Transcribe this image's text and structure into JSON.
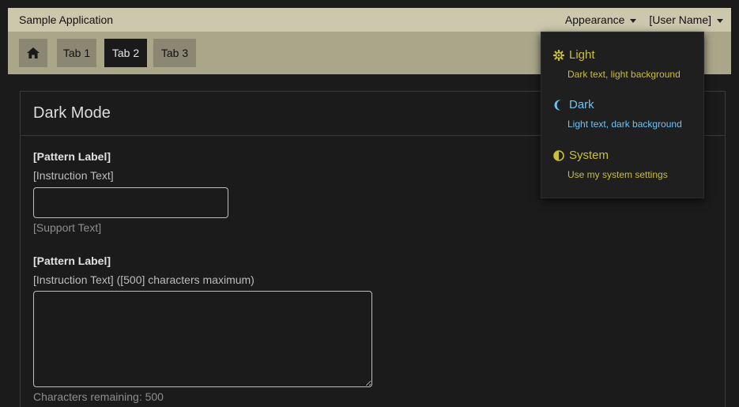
{
  "app": {
    "title": "Sample Application"
  },
  "header": {
    "appearance_label": "Appearance",
    "user_label": "[User Name]"
  },
  "tabs": [
    {
      "label": "Tab 1"
    },
    {
      "label": "Tab 2",
      "active": true
    },
    {
      "label": "Tab 3"
    }
  ],
  "panel": {
    "title": "Dark Mode",
    "field1": {
      "label": "[Pattern Label]",
      "instruction": "[Instruction Text]",
      "value": "",
      "support": "[Support Text]"
    },
    "field2": {
      "label": "[Pattern Label]",
      "instruction": "[Instruction Text] ([500] characters maximum)",
      "value": "",
      "remaining": "Characters remaining: 500"
    }
  },
  "appearance_menu": {
    "options": [
      {
        "icon": "gear-icon",
        "label": "Light",
        "description": "Dark text, light background",
        "color": "#c9bf3a"
      },
      {
        "icon": "moon-icon",
        "label": "Dark",
        "description": "Light text, dark background",
        "color": "#6fc2f2",
        "selected": true
      },
      {
        "icon": "half-circle-icon",
        "label": "System",
        "description": "Use my system settings",
        "color": "#c9bf3a"
      }
    ]
  },
  "colors": {
    "topbar": "#cbc8ad",
    "tabbar": "#a9a68a",
    "tab": "#8a8773",
    "active_tab": "#1a1a1a",
    "background": "#1b1b1b"
  }
}
